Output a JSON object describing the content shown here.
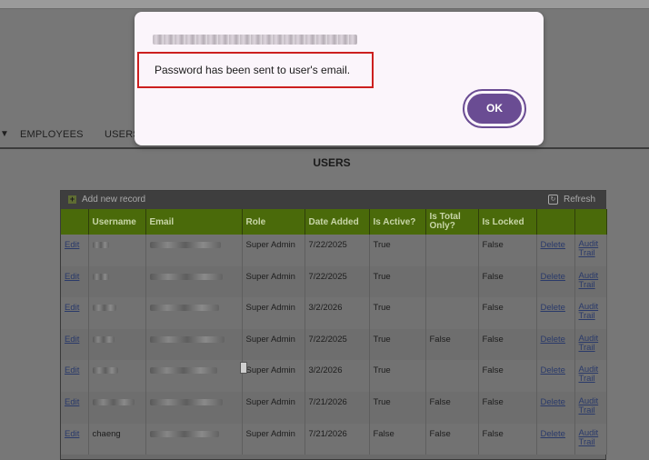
{
  "nav": {
    "items": [
      "EMPLOYEES",
      "USERS"
    ]
  },
  "section_title": "USERS",
  "grid": {
    "add_label": "Add new record",
    "refresh_label": "Refresh",
    "headers": [
      "",
      "Username",
      "Email",
      "Role",
      "Date Added",
      "Is Active?",
      "Is Total Only?",
      "Is Locked",
      "",
      ""
    ],
    "rows": [
      {
        "edit": "Edit",
        "username": "",
        "role": "Super Admin",
        "date_added": "7/22/2025",
        "is_active": "True",
        "is_total_only": "",
        "is_locked": "False",
        "delete": "Delete",
        "audit": "Audit Trail"
      },
      {
        "edit": "Edit",
        "username": "",
        "role": "Super Admin",
        "date_added": "7/22/2025",
        "is_active": "True",
        "is_total_only": "",
        "is_locked": "False",
        "delete": "Delete",
        "audit": "Audit Trail"
      },
      {
        "edit": "Edit",
        "username": "",
        "role": "Super Admin",
        "date_added": "3/2/2026",
        "is_active": "True",
        "is_total_only": "",
        "is_locked": "False",
        "delete": "Delete",
        "audit": "Audit Trail"
      },
      {
        "edit": "Edit",
        "username": "",
        "role": "Super Admin",
        "date_added": "7/22/2025",
        "is_active": "True",
        "is_total_only": "False",
        "is_locked": "False",
        "delete": "Delete",
        "audit": "Audit Trail"
      },
      {
        "edit": "Edit",
        "username": "",
        "role": "Super Admin",
        "date_added": "3/2/2026",
        "is_active": "True",
        "is_total_only": "",
        "is_locked": "False",
        "delete": "Delete",
        "audit": "Audit Trail"
      },
      {
        "edit": "Edit",
        "username": "",
        "role": "Super Admin",
        "date_added": "7/21/2026",
        "is_active": "True",
        "is_total_only": "False",
        "is_locked": "False",
        "delete": "Delete",
        "audit": "Audit Trail"
      },
      {
        "edit": "Edit",
        "username": "chaeng",
        "role": "Super Admin",
        "date_added": "7/21/2026",
        "is_active": "False",
        "is_total_only": "False",
        "is_locked": "False",
        "delete": "Delete",
        "audit": "Audit Trail"
      }
    ]
  },
  "dialog": {
    "message": "Password has been sent to user's email.",
    "ok_label": "OK"
  },
  "colors": {
    "overlay": "#777777",
    "header_green": "#4a6a0a",
    "dialog_bg": "#fbf5fb",
    "ok_purple": "#6a4c93",
    "highlight_red": "#cc1f1f"
  }
}
